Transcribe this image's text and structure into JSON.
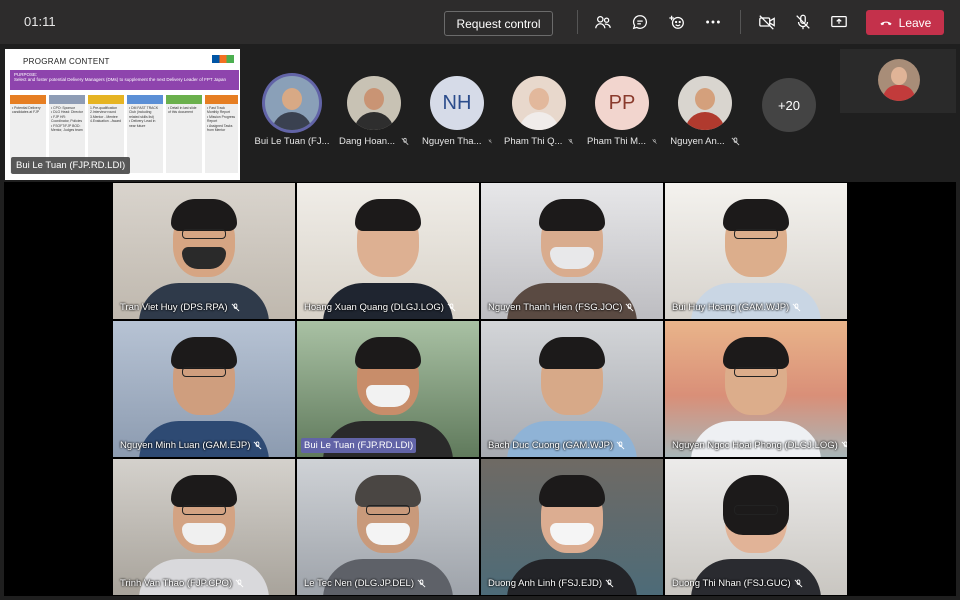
{
  "call": {
    "timer": "01:11",
    "request_control_label": "Request control",
    "leave_label": "Leave"
  },
  "colors": {
    "leave": "#c4314b",
    "active_ring": "#6264a7",
    "topbar": "#2d2c2c"
  },
  "shared_content": {
    "title": "PROGRAM CONTENT",
    "purpose": "PURPOSE:\nSelect and foster potential Delivery Managers (DMs) to supplement the next Delivery Leader of FPT Japan",
    "presenter": "Bui Le Tuan (FJP.RD.LDI)",
    "columns": [
      {
        "head": "INPUT",
        "body": "• Potential Delivery candidates at FJP"
      },
      {
        "head": "ORG",
        "body": "• CPO: Sponsor\n• DLG Head: Director\n• FJP HR: Coordinator, Policies\n• FSOFT/FJP BOD: Mentor, Judges team"
      },
      {
        "head": "PROCESS",
        "body": "1.Pre-qualification\n2.Interview round\n3.Mentor - Mentee\n4.Evaluation - Award"
      },
      {
        "head": "OUTPUT",
        "body": "• DM FAST TRACK Club (including related skills list)\n• Delivery Lead in near future"
      },
      {
        "head": "DM BENEFITS",
        "body": "• Detail in last slide of this document"
      },
      {
        "head": "DM ACCOUNTABILITY",
        "body": "• Fast Track Monthly Report\n• Mission Progress Report\n• Assigned Tasks from Mentor"
      }
    ]
  },
  "participants": [
    {
      "name": "Bui Le Tuan (FJ...",
      "type": "photo",
      "active": true
    },
    {
      "name": "Dang Hoan...",
      "type": "photo"
    },
    {
      "name": "Nguyen Tha...",
      "type": "initials",
      "initials": "NH"
    },
    {
      "name": "Pham Thi Q...",
      "type": "photo"
    },
    {
      "name": "Pham Thi M...",
      "type": "initials",
      "initials": "PP"
    },
    {
      "name": "Nguyen An...",
      "type": "photo"
    }
  ],
  "more_count": "+20",
  "tiles": [
    {
      "name": "Tran Viet Huy (DPS.RPA)"
    },
    {
      "name": "Hoang Xuan Quang (DLGJ.LOG)"
    },
    {
      "name": "Nguyen Thanh Hien (FSG.JOC)"
    },
    {
      "name": "Bui Huy Hoang (GAM.WJP)"
    },
    {
      "name": "Nguyen Minh Luan (GAM.EJP)"
    },
    {
      "name": "Bui Le Tuan (FJP.RD.LDI)",
      "highlight": true
    },
    {
      "name": "Bach Duc Cuong (GAM.WJP)"
    },
    {
      "name": "Nguyen Ngoc Hoai Phong (DLGJ.LOG)"
    },
    {
      "name": "Trinh Van Thao (FJP.CPO)"
    },
    {
      "name": "Le Tec Nen (DLG.JP.DEL)"
    },
    {
      "name": "Duong Anh Linh (FSJ.EJD)"
    },
    {
      "name": "Duong Thi Nhan (FSJ.GUC)"
    }
  ]
}
